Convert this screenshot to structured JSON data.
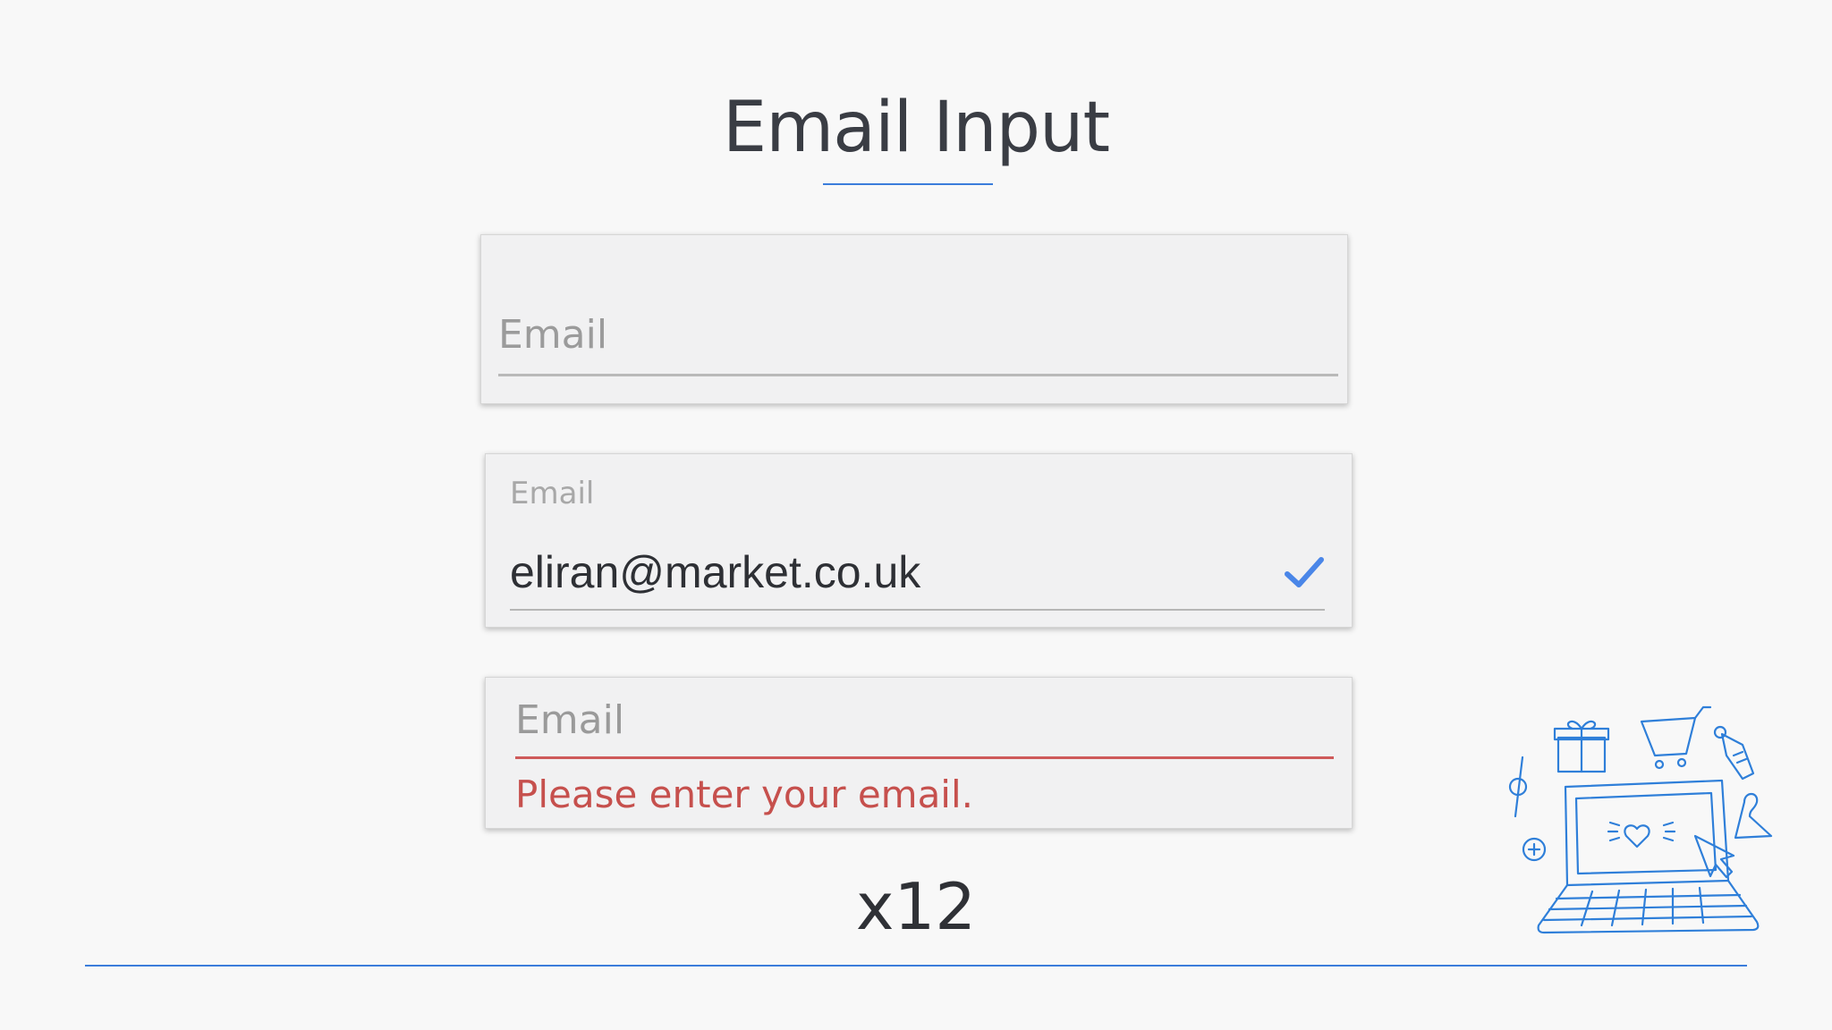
{
  "page": {
    "title": "Email Input",
    "multiplier": "x12"
  },
  "inputs": {
    "empty": {
      "placeholder": "Email"
    },
    "filled": {
      "label": "Email",
      "value": "eliran@market.co.uk",
      "status_icon": "checkmark-icon"
    },
    "error": {
      "placeholder": "Email",
      "error_message": "Please enter your email."
    }
  },
  "colors": {
    "accent": "#3b7ddb",
    "error": "#c6504d",
    "text": "#3a3d44",
    "check": "#4a86e8"
  },
  "illustration": {
    "icon": "ecommerce-laptop-illustration"
  }
}
